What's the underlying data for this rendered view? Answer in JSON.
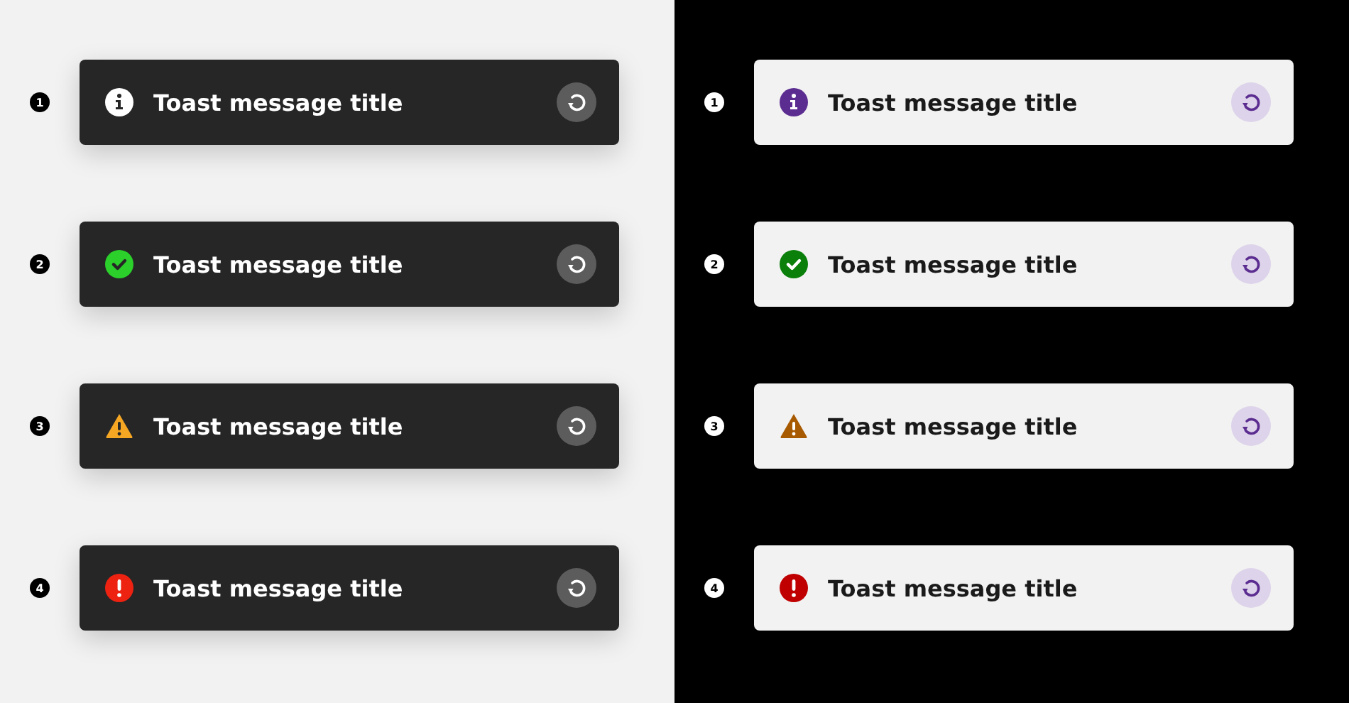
{
  "panels": [
    {
      "dark": false,
      "toasts": [
        {
          "number": "1",
          "kind": "info",
          "title": "Toast message title"
        },
        {
          "number": "2",
          "kind": "success",
          "title": "Toast message title"
        },
        {
          "number": "3",
          "kind": "warning",
          "title": "Toast message title"
        },
        {
          "number": "4",
          "kind": "error",
          "title": "Toast message title"
        }
      ]
    },
    {
      "dark": true,
      "toasts": [
        {
          "number": "1",
          "kind": "info",
          "title": "Toast message title"
        },
        {
          "number": "2",
          "kind": "success",
          "title": "Toast message title"
        },
        {
          "number": "3",
          "kind": "warning",
          "title": "Toast message title"
        },
        {
          "number": "4",
          "kind": "error",
          "title": "Toast message title"
        }
      ]
    }
  ]
}
